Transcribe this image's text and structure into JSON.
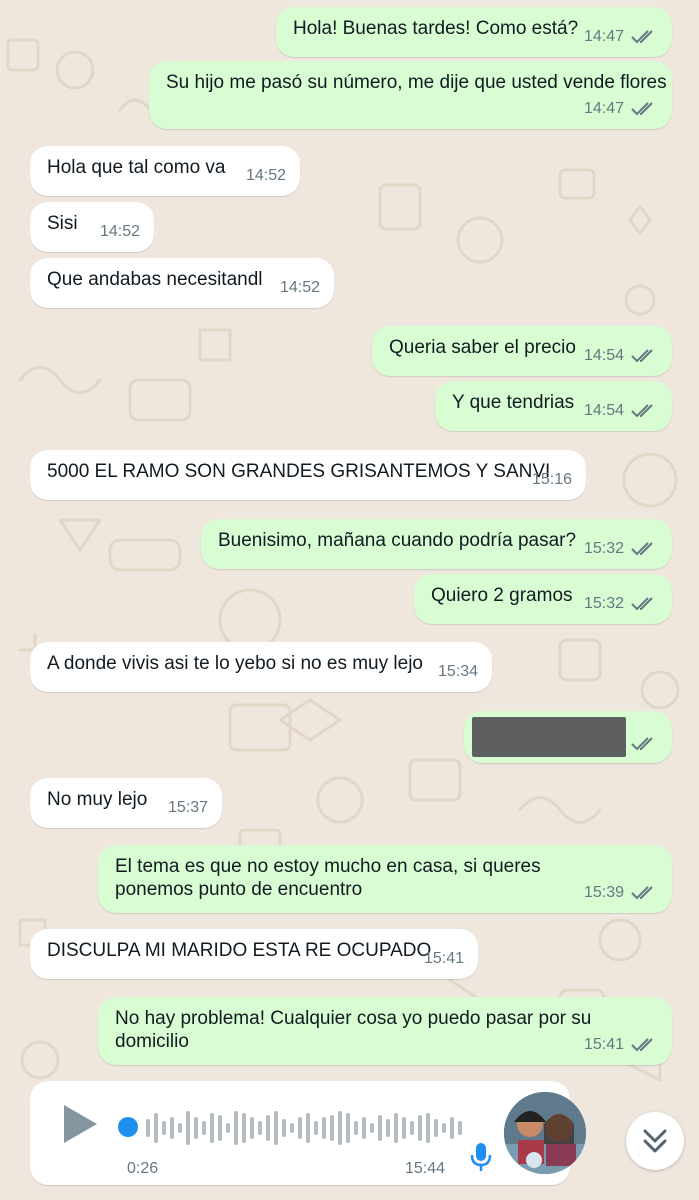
{
  "messages": [
    {
      "dir": "out",
      "text": "Hola! Buenas tardes! Como está?",
      "time": "14:47"
    },
    {
      "dir": "out",
      "text": "Su hijo me pasó su número, me dije que usted vende flores",
      "time": "14:47"
    },
    {
      "dir": "in",
      "text": "Hola que tal como va",
      "time": "14:52"
    },
    {
      "dir": "in",
      "text": "Sisi",
      "time": "14:52"
    },
    {
      "dir": "in",
      "text": "Que andabas necesitandl",
      "time": "14:52"
    },
    {
      "dir": "out",
      "text": "Queria saber el precio",
      "time": "14:54"
    },
    {
      "dir": "out",
      "text": "Y que tendrias",
      "time": "14:54"
    },
    {
      "dir": "in",
      "text": "5000 EL RAMO SON GRANDES GRISANTEMOS Y SANVI",
      "time": "15:16"
    },
    {
      "dir": "out",
      "text": "Buenisimo, mañana cuando podría pasar?",
      "time": "15:32"
    },
    {
      "dir": "out",
      "text": "Quiero 2 gramos",
      "time": "15:32"
    },
    {
      "dir": "in",
      "text": "A donde vivis asi te lo yebo si no es muy lejo",
      "time": "15:34"
    },
    {
      "dir": "out",
      "text": "",
      "time": ""
    },
    {
      "dir": "in",
      "text": "No muy lejo",
      "time": "15:37"
    },
    {
      "dir": "out",
      "text": "El tema es que no estoy mucho en casa, si queres ponemos punto de encuentro",
      "time": "15:39"
    },
    {
      "dir": "in",
      "text": "DISCULPA MI MARIDO ESTA RE OCUPADO",
      "time": "15:41"
    },
    {
      "dir": "out",
      "text": "No hay problema! Cualquier cosa yo puedo pasar por su domicilio",
      "time": "15:41"
    }
  ],
  "voice_note": {
    "duration": "0:26",
    "time": "15:44",
    "progress": 0.0
  },
  "colors": {
    "outgoing": "#d9fdd3",
    "incoming": "#ffffff",
    "background": "#efe7dd",
    "meta": "#667781",
    "play_dot": "#1f8ff0",
    "mic": "#1f8ff0"
  },
  "icons": [
    "double-check-icon",
    "play-icon",
    "mic-icon",
    "avatar",
    "chevron-double-down-icon"
  ]
}
